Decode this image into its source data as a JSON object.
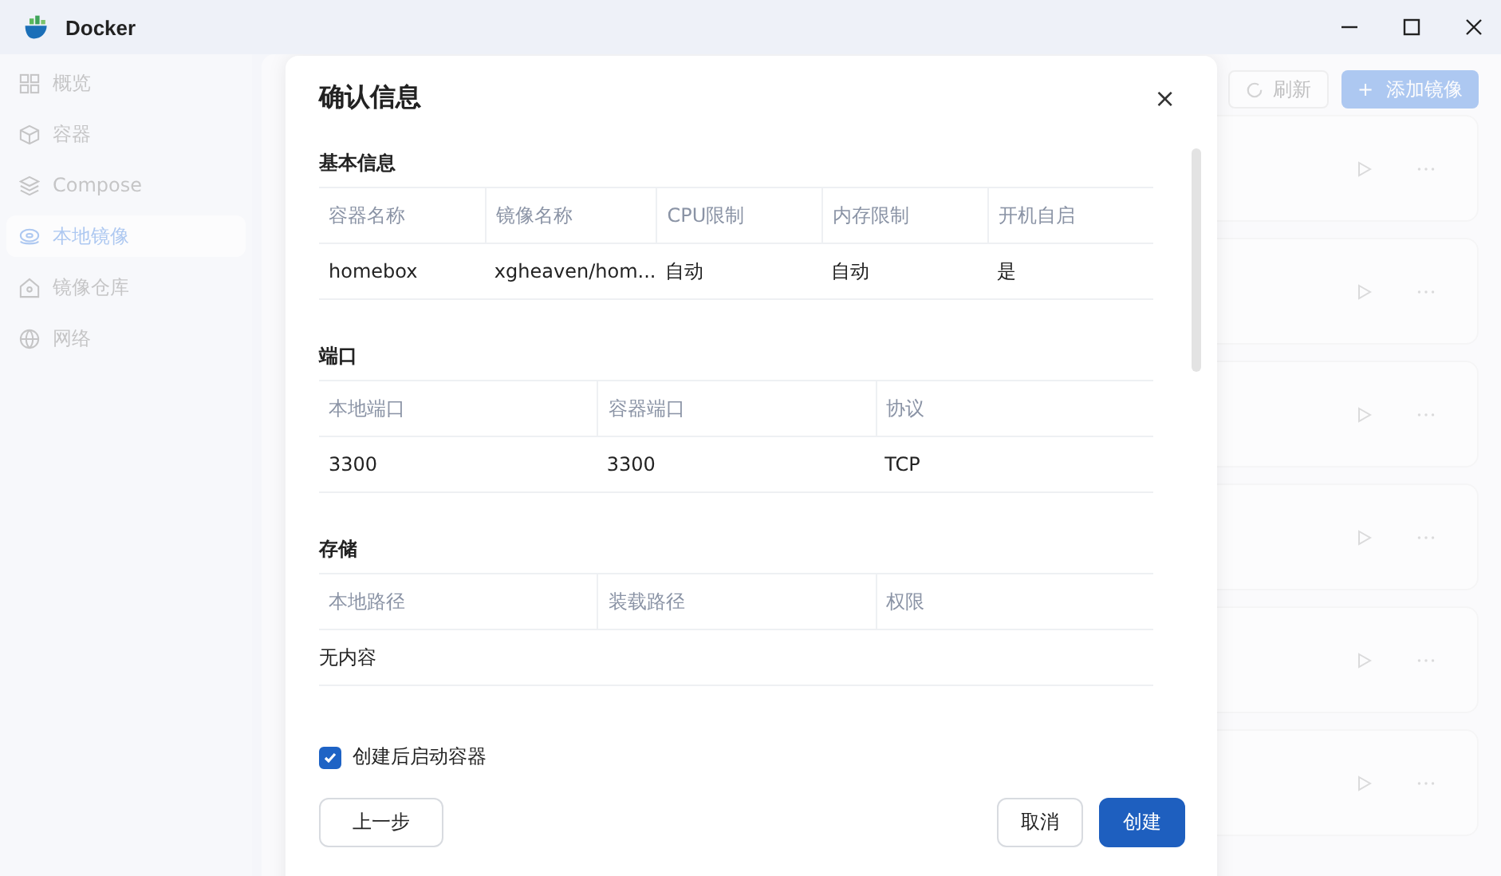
{
  "window": {
    "title": "Docker"
  },
  "sidebar": {
    "items": [
      {
        "label": "概览",
        "selected": false
      },
      {
        "label": "容器",
        "selected": false
      },
      {
        "label": "Compose",
        "selected": false
      },
      {
        "label": "本地镜像",
        "selected": true
      },
      {
        "label": "镜像仓库",
        "selected": false
      },
      {
        "label": "网络",
        "selected": false
      }
    ]
  },
  "main": {
    "refresh_button": "刷新",
    "add_button_icon": "+",
    "add_button": "添加镜像"
  },
  "dialog": {
    "title": "确认信息",
    "close": "×",
    "sections": [
      {
        "title": "基本信息",
        "columns": [
          "容器名称",
          "镜像名称",
          "CPU限制",
          "内存限制",
          "开机自启"
        ],
        "rows": [
          [
            "homebox",
            "xgheaven/hom...",
            "自动",
            "自动",
            "是"
          ]
        ]
      },
      {
        "title": "端口",
        "columns": [
          "本地端口",
          "容器端口",
          "协议"
        ],
        "rows": [
          [
            "3300",
            "3300",
            "TCP"
          ]
        ]
      },
      {
        "title": "存储",
        "columns": [
          "本地路径",
          "装载路径",
          "权限"
        ],
        "empty": "无内容"
      }
    ],
    "start_after_create": {
      "label": "创建后启动容器",
      "checked": true
    },
    "buttons": [
      {
        "label": "上一步",
        "kind": "secondary"
      },
      {
        "label": "取消",
        "kind": "secondary"
      },
      {
        "label": "创建",
        "kind": "primary"
      }
    ]
  }
}
